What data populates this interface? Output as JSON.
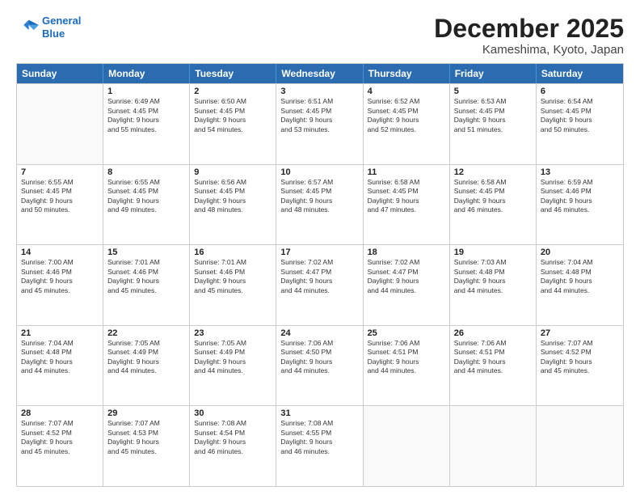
{
  "header": {
    "logo_line1": "General",
    "logo_line2": "Blue",
    "title": "December 2025",
    "subtitle": "Kameshima, Kyoto, Japan"
  },
  "weekdays": [
    "Sunday",
    "Monday",
    "Tuesday",
    "Wednesday",
    "Thursday",
    "Friday",
    "Saturday"
  ],
  "rows": [
    [
      {
        "day": "",
        "lines": []
      },
      {
        "day": "1",
        "lines": [
          "Sunrise: 6:49 AM",
          "Sunset: 4:45 PM",
          "Daylight: 9 hours",
          "and 55 minutes."
        ]
      },
      {
        "day": "2",
        "lines": [
          "Sunrise: 6:50 AM",
          "Sunset: 4:45 PM",
          "Daylight: 9 hours",
          "and 54 minutes."
        ]
      },
      {
        "day": "3",
        "lines": [
          "Sunrise: 6:51 AM",
          "Sunset: 4:45 PM",
          "Daylight: 9 hours",
          "and 53 minutes."
        ]
      },
      {
        "day": "4",
        "lines": [
          "Sunrise: 6:52 AM",
          "Sunset: 4:45 PM",
          "Daylight: 9 hours",
          "and 52 minutes."
        ]
      },
      {
        "day": "5",
        "lines": [
          "Sunrise: 6:53 AM",
          "Sunset: 4:45 PM",
          "Daylight: 9 hours",
          "and 51 minutes."
        ]
      },
      {
        "day": "6",
        "lines": [
          "Sunrise: 6:54 AM",
          "Sunset: 4:45 PM",
          "Daylight: 9 hours",
          "and 50 minutes."
        ]
      }
    ],
    [
      {
        "day": "7",
        "lines": [
          "Sunrise: 6:55 AM",
          "Sunset: 4:45 PM",
          "Daylight: 9 hours",
          "and 50 minutes."
        ]
      },
      {
        "day": "8",
        "lines": [
          "Sunrise: 6:55 AM",
          "Sunset: 4:45 PM",
          "Daylight: 9 hours",
          "and 49 minutes."
        ]
      },
      {
        "day": "9",
        "lines": [
          "Sunrise: 6:56 AM",
          "Sunset: 4:45 PM",
          "Daylight: 9 hours",
          "and 48 minutes."
        ]
      },
      {
        "day": "10",
        "lines": [
          "Sunrise: 6:57 AM",
          "Sunset: 4:45 PM",
          "Daylight: 9 hours",
          "and 48 minutes."
        ]
      },
      {
        "day": "11",
        "lines": [
          "Sunrise: 6:58 AM",
          "Sunset: 4:45 PM",
          "Daylight: 9 hours",
          "and 47 minutes."
        ]
      },
      {
        "day": "12",
        "lines": [
          "Sunrise: 6:58 AM",
          "Sunset: 4:45 PM",
          "Daylight: 9 hours",
          "and 46 minutes."
        ]
      },
      {
        "day": "13",
        "lines": [
          "Sunrise: 6:59 AM",
          "Sunset: 4:46 PM",
          "Daylight: 9 hours",
          "and 46 minutes."
        ]
      }
    ],
    [
      {
        "day": "14",
        "lines": [
          "Sunrise: 7:00 AM",
          "Sunset: 4:46 PM",
          "Daylight: 9 hours",
          "and 45 minutes."
        ]
      },
      {
        "day": "15",
        "lines": [
          "Sunrise: 7:01 AM",
          "Sunset: 4:46 PM",
          "Daylight: 9 hours",
          "and 45 minutes."
        ]
      },
      {
        "day": "16",
        "lines": [
          "Sunrise: 7:01 AM",
          "Sunset: 4:46 PM",
          "Daylight: 9 hours",
          "and 45 minutes."
        ]
      },
      {
        "day": "17",
        "lines": [
          "Sunrise: 7:02 AM",
          "Sunset: 4:47 PM",
          "Daylight: 9 hours",
          "and 44 minutes."
        ]
      },
      {
        "day": "18",
        "lines": [
          "Sunrise: 7:02 AM",
          "Sunset: 4:47 PM",
          "Daylight: 9 hours",
          "and 44 minutes."
        ]
      },
      {
        "day": "19",
        "lines": [
          "Sunrise: 7:03 AM",
          "Sunset: 4:48 PM",
          "Daylight: 9 hours",
          "and 44 minutes."
        ]
      },
      {
        "day": "20",
        "lines": [
          "Sunrise: 7:04 AM",
          "Sunset: 4:48 PM",
          "Daylight: 9 hours",
          "and 44 minutes."
        ]
      }
    ],
    [
      {
        "day": "21",
        "lines": [
          "Sunrise: 7:04 AM",
          "Sunset: 4:48 PM",
          "Daylight: 9 hours",
          "and 44 minutes."
        ]
      },
      {
        "day": "22",
        "lines": [
          "Sunrise: 7:05 AM",
          "Sunset: 4:49 PM",
          "Daylight: 9 hours",
          "and 44 minutes."
        ]
      },
      {
        "day": "23",
        "lines": [
          "Sunrise: 7:05 AM",
          "Sunset: 4:49 PM",
          "Daylight: 9 hours",
          "and 44 minutes."
        ]
      },
      {
        "day": "24",
        "lines": [
          "Sunrise: 7:06 AM",
          "Sunset: 4:50 PM",
          "Daylight: 9 hours",
          "and 44 minutes."
        ]
      },
      {
        "day": "25",
        "lines": [
          "Sunrise: 7:06 AM",
          "Sunset: 4:51 PM",
          "Daylight: 9 hours",
          "and 44 minutes."
        ]
      },
      {
        "day": "26",
        "lines": [
          "Sunrise: 7:06 AM",
          "Sunset: 4:51 PM",
          "Daylight: 9 hours",
          "and 44 minutes."
        ]
      },
      {
        "day": "27",
        "lines": [
          "Sunrise: 7:07 AM",
          "Sunset: 4:52 PM",
          "Daylight: 9 hours",
          "and 45 minutes."
        ]
      }
    ],
    [
      {
        "day": "28",
        "lines": [
          "Sunrise: 7:07 AM",
          "Sunset: 4:52 PM",
          "Daylight: 9 hours",
          "and 45 minutes."
        ]
      },
      {
        "day": "29",
        "lines": [
          "Sunrise: 7:07 AM",
          "Sunset: 4:53 PM",
          "Daylight: 9 hours",
          "and 45 minutes."
        ]
      },
      {
        "day": "30",
        "lines": [
          "Sunrise: 7:08 AM",
          "Sunset: 4:54 PM",
          "Daylight: 9 hours",
          "and 46 minutes."
        ]
      },
      {
        "day": "31",
        "lines": [
          "Sunrise: 7:08 AM",
          "Sunset: 4:55 PM",
          "Daylight: 9 hours",
          "and 46 minutes."
        ]
      },
      {
        "day": "",
        "lines": []
      },
      {
        "day": "",
        "lines": []
      },
      {
        "day": "",
        "lines": []
      }
    ]
  ]
}
